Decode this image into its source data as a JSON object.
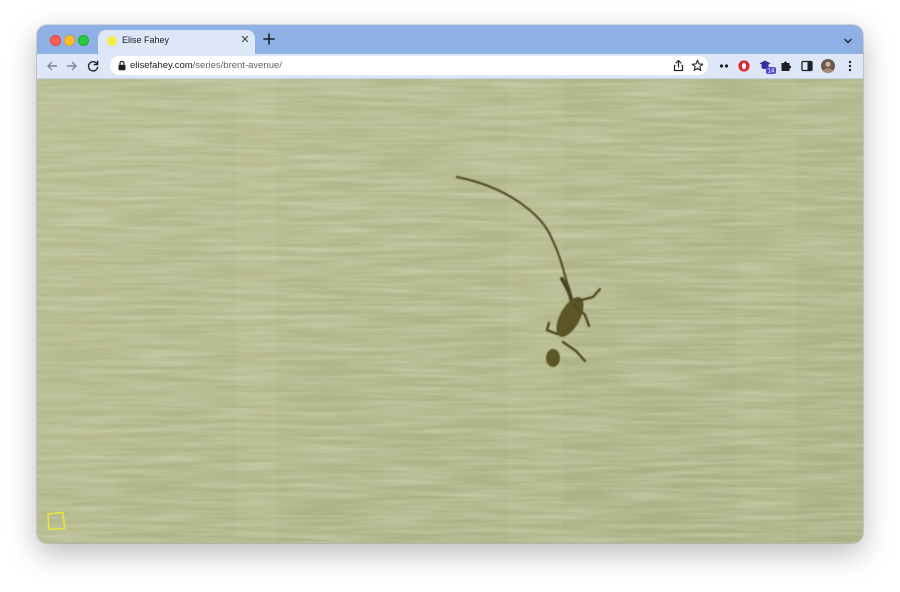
{
  "browser": {
    "tab": {
      "title": "Elise Fahey",
      "favicon_color": "#f3ee45"
    },
    "new_tab_icon": "plus-icon",
    "address": {
      "host": "elisefahey.com",
      "path": "/series/brent-avenue/"
    },
    "extensions_badge": "14",
    "colors": {
      "tabstrip": "#8fb0e4",
      "toolbar": "#dde7f8"
    }
  },
  "page": {
    "image_subject": "gecko on painted wall",
    "background_color": "#b5b98d",
    "corner_icon": "square-outline-icon",
    "corner_color": "#e8e83a"
  }
}
